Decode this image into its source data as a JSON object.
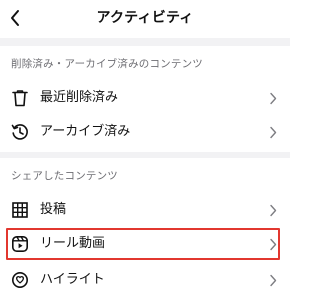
{
  "header": {
    "title": "アクティビティ",
    "back_icon": "chevron-left-icon"
  },
  "sections": [
    {
      "title": "削除済み・アーカイブ済みのコンテンツ",
      "items": [
        {
          "label": "最近削除済み",
          "icon": "trash-icon"
        },
        {
          "label": "アーカイブ済み",
          "icon": "archive-history-icon"
        }
      ]
    },
    {
      "title": "シェアしたコンテンツ",
      "items": [
        {
          "label": "投稿",
          "icon": "grid-icon"
        },
        {
          "label": "リール動画",
          "icon": "reels-icon",
          "highlighted": true
        },
        {
          "label": "ハイライト",
          "icon": "highlight-icon"
        }
      ]
    }
  ],
  "colors": {
    "highlight_border": "#e2372f",
    "section_text": "#6e6e73",
    "divider_band": "#f2f2f4"
  }
}
